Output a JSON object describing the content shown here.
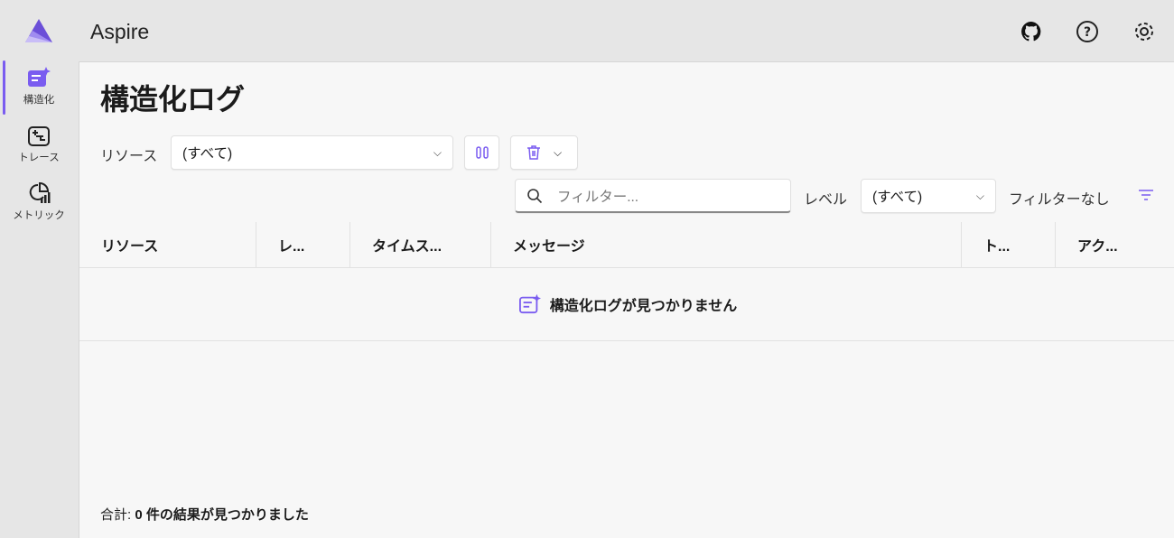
{
  "app": {
    "title": "Aspire",
    "accent": "#7a5cf0"
  },
  "sidebar": {
    "items": [
      {
        "label": "構造化",
        "icon": "structured-logs-icon",
        "active": true
      },
      {
        "label": "トレース",
        "icon": "traces-icon"
      },
      {
        "label": "メトリック",
        "icon": "metrics-icon"
      }
    ]
  },
  "header_icons": [
    "github-icon",
    "help-icon",
    "settings-icon"
  ],
  "page": {
    "title": "構造化ログ"
  },
  "toolbar": {
    "resource_label": "リソース",
    "resource_value": "(すべて)",
    "pause_icon": "pause-icon",
    "delete_icon": "trash-icon"
  },
  "filter": {
    "placeholder": "フィルター...",
    "level_label": "レベル",
    "level_value": "(すべて)",
    "no_filter": "フィルターなし"
  },
  "table": {
    "columns": [
      "リソース",
      "レ...",
      "タイムス...",
      "メッセージ",
      "ト...",
      "アク..."
    ],
    "empty_message": "構造化ログが見つかりません"
  },
  "footer": {
    "total_label": "合計:",
    "total_text": "0 件の結果が見つかりました"
  }
}
